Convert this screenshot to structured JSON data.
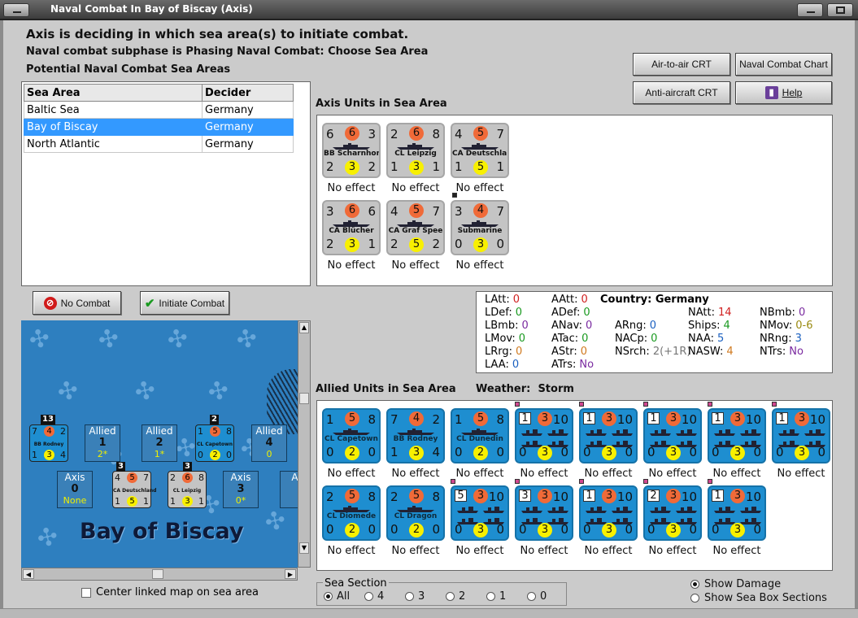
{
  "window": {
    "title": "Naval Combat In Bay of Biscay (Axis)"
  },
  "status": {
    "line1": "Axis is deciding in which sea area(s) to initiate combat.",
    "line2": "Naval combat subphase is Phasing Naval Combat: Choose Sea Area",
    "line3": "Potential Naval Combat Sea Areas"
  },
  "buttons": {
    "air_to_air": "Air-to-air CRT",
    "naval_chart": "Naval Combat Chart",
    "anti_aircraft": "Anti-aircraft CRT",
    "help": "Help",
    "no_combat": "No Combat",
    "initiate_combat": "Initiate Combat"
  },
  "sea_table": {
    "headers": [
      "Sea Area",
      "Decider"
    ],
    "rows": [
      [
        "Baltic Sea",
        "Germany"
      ],
      [
        "Bay of Biscay",
        "Germany"
      ],
      [
        "North Atlantic",
        "Germany"
      ]
    ],
    "selected": 1
  },
  "axis_section": {
    "title": "Axis Units in Sea Area"
  },
  "allied_section": {
    "title": "Allied Units in Sea Area",
    "weather_label": "Weather:",
    "weather": "Storm"
  },
  "axis_units": [
    {
      "tl": "6",
      "top": "6",
      "tr": "3",
      "name": "BB Scharnhorst",
      "bl": "2",
      "bot": "3",
      "br": "2",
      "effect": "No effect"
    },
    {
      "tl": "2",
      "top": "6",
      "tr": "8",
      "name": "CL Leipzig",
      "bl": "1",
      "bot": "3",
      "br": "1",
      "effect": "No effect"
    },
    {
      "tl": "4",
      "top": "5",
      "tr": "7",
      "name": "CA Deutschland",
      "bl": "1",
      "bot": "5",
      "br": "1",
      "effect": "No effect"
    },
    {
      "tl": "3",
      "top": "6",
      "tr": "6",
      "name": "CA Blücher",
      "bl": "2",
      "bot": "3",
      "br": "1",
      "effect": "No effect"
    },
    {
      "tl": "4",
      "top": "5",
      "tr": "7",
      "name": "CA Graf Spee",
      "bl": "2",
      "bot": "5",
      "br": "2",
      "effect": "No effect"
    },
    {
      "tl": "3",
      "top": "4",
      "tr": "7",
      "name": "Submarine",
      "bl": "0",
      "bot": "3",
      "br": "0",
      "effect": "No effect"
    }
  ],
  "allied_units": [
    {
      "tl": "1",
      "top": "5",
      "tr": "8",
      "name": "CL Capetown",
      "bl": "0",
      "bot": "2",
      "br": "0",
      "effect": "No effect"
    },
    {
      "tl": "7",
      "top": "4",
      "tr": "2",
      "name": "BB Rodney",
      "bl": "1",
      "bot": "3",
      "br": "4",
      "effect": "No effect"
    },
    {
      "tl": "1",
      "top": "5",
      "tr": "8",
      "name": "CL Dunedin",
      "bl": "0",
      "bot": "2",
      "br": "0",
      "effect": "No effect"
    },
    {
      "tl": "1",
      "top": "3",
      "tr": "10",
      "name": "",
      "bl": "0",
      "bot": "3",
      "br": "0",
      "effect": "No effect"
    },
    {
      "tl": "1",
      "top": "3",
      "tr": "10",
      "name": "",
      "bl": "0",
      "bot": "3",
      "br": "0",
      "effect": "No effect"
    },
    {
      "tl": "1",
      "top": "3",
      "tr": "10",
      "name": "",
      "bl": "0",
      "bot": "3",
      "br": "0",
      "effect": "No effect"
    },
    {
      "tl": "1",
      "top": "3",
      "tr": "10",
      "name": "",
      "bl": "0",
      "bot": "3",
      "br": "0",
      "effect": "No effect"
    },
    {
      "tl": "1",
      "top": "3",
      "tr": "10",
      "name": "",
      "bl": "0",
      "bot": "3",
      "br": "0",
      "effect": "No effect"
    },
    {
      "tl": "2",
      "top": "5",
      "tr": "8",
      "name": "CL Diomede",
      "bl": "0",
      "bot": "2",
      "br": "0",
      "effect": "No effect"
    },
    {
      "tl": "2",
      "top": "5",
      "tr": "8",
      "name": "CL Dragon",
      "bl": "0",
      "bot": "2",
      "br": "0",
      "effect": "No effect"
    },
    {
      "tl": "5",
      "top": "3",
      "tr": "10",
      "name": "",
      "bl": "0",
      "bot": "3",
      "br": "0",
      "effect": "No effect"
    },
    {
      "tl": "3",
      "top": "3",
      "tr": "10",
      "name": "",
      "bl": "0",
      "bot": "3",
      "br": "0",
      "effect": "No effect"
    },
    {
      "tl": "1",
      "top": "3",
      "tr": "10",
      "name": "",
      "bl": "0",
      "bot": "3",
      "br": "0",
      "effect": "No effect"
    },
    {
      "tl": "2",
      "top": "3",
      "tr": "10",
      "name": "",
      "bl": "0",
      "bot": "3",
      "br": "0",
      "effect": "No effect"
    },
    {
      "tl": "1",
      "top": "3",
      "tr": "10",
      "name": "",
      "bl": "0",
      "bot": "3",
      "br": "0",
      "effect": "No effect"
    }
  ],
  "country_stats": {
    "country_label": "Country:",
    "country": "Germany",
    "left": [
      {
        "k": "LAtt:",
        "v": "0"
      },
      {
        "k": "LDef:",
        "v": "0"
      },
      {
        "k": "LBmb:",
        "v": "0"
      },
      {
        "k": "LMov:",
        "v": "0"
      },
      {
        "k": "LRrg:",
        "v": "0"
      },
      {
        "k": "LAA:",
        "v": "0"
      }
    ],
    "mid": [
      {
        "k": "AAtt:",
        "v": "0"
      },
      {
        "k": "ADef:",
        "v": "0"
      },
      {
        "k": "ANav:",
        "v": "0"
      },
      {
        "k": "ATac:",
        "v": "0"
      },
      {
        "k": "AStr:",
        "v": "0"
      },
      {
        "k": "ATrs:",
        "v": "No"
      }
    ],
    "mid2": [
      {
        "k": "ARng:",
        "v": "0"
      },
      {
        "k": "NACp:",
        "v": "0"
      },
      {
        "k": "NSrch:",
        "v": "2(+1R)"
      }
    ],
    "right": [
      {
        "k": "NAtt:",
        "v": "14"
      },
      {
        "k": "Ships:",
        "v": "4"
      },
      {
        "k": "NAA:",
        "v": "5"
      },
      {
        "k": "NASW:",
        "v": "4"
      }
    ],
    "far": [
      {
        "k": "NBmb:",
        "v": "0"
      },
      {
        "k": "NMov:",
        "v": "0-6"
      },
      {
        "k": "NRng:",
        "v": "3"
      },
      {
        "k": "NTrs:",
        "v": "No"
      }
    ]
  },
  "map": {
    "label": "Bay of Biscay",
    "allied_boxes": [
      {
        "side": "Allied",
        "num": "1",
        "sub": "2*"
      },
      {
        "side": "Allied",
        "num": "2",
        "sub": "1*"
      },
      {
        "side": "Allied",
        "num": "4",
        "sub": "0"
      }
    ],
    "axis_boxes": [
      {
        "side": "Axis",
        "num": "0",
        "sub": "None"
      },
      {
        "side": "Axis",
        "num": "3",
        "sub": "0*"
      },
      {
        "side": "Ax",
        "num": "",
        "sub": ""
      }
    ],
    "stack_counts": [
      "13",
      "2",
      "3",
      "3"
    ],
    "mini_counters": [
      {
        "tl": "7",
        "top": "4",
        "tr": "2",
        "name": "BB Rodney",
        "bl": "1",
        "bot": "3",
        "br": "4"
      },
      {
        "tl": "1",
        "top": "5",
        "tr": "8",
        "name": "CL Capetown",
        "bl": "0",
        "bot": "2",
        "br": "0"
      },
      {
        "tl": "4",
        "top": "5",
        "tr": "7",
        "name": "CA Deutschland",
        "bl": "1",
        "bot": "5",
        "br": "1"
      },
      {
        "tl": "2",
        "top": "6",
        "tr": "8",
        "name": "CL Leipzig",
        "bl": "1",
        "bot": "3",
        "br": "1"
      }
    ]
  },
  "center_map": {
    "label": "Center linked map on sea area"
  },
  "sea_section": {
    "title": "Sea Section",
    "options": [
      "All",
      "4",
      "3",
      "2",
      "1",
      "0"
    ],
    "selected": 0
  },
  "display_options": {
    "show_damage": "Show Damage",
    "show_boxes": "Show Sea Box Sections"
  },
  "colors": {
    "allied_counter": "#1e8ed0",
    "axis_counter": "#c4c4c4",
    "attack_dot": "#f06a38",
    "defense_dot": "#f8f000",
    "selection": "#3399ff"
  }
}
